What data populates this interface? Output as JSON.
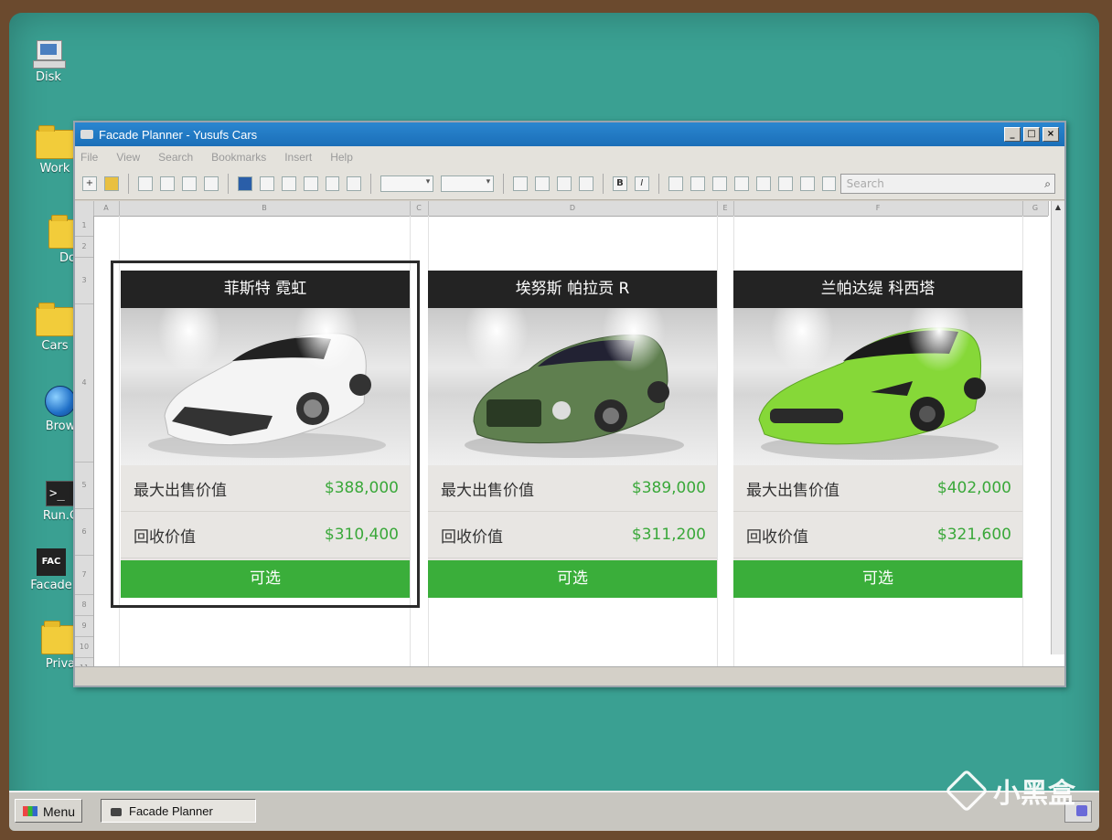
{
  "desktop": {
    "icons": [
      {
        "label": "Disk",
        "icon": "computer-icon"
      },
      {
        "label": "Work",
        "icon": "folder-icon"
      },
      {
        "label": "Do",
        "icon": "folder-icon"
      },
      {
        "label": "Cars",
        "icon": "folder-icon"
      },
      {
        "label": "Brow",
        "icon": "globe-icon"
      },
      {
        "label": "Run.C",
        "icon": "terminal-icon"
      },
      {
        "label": "Facade",
        "icon": "facade-app-icon"
      },
      {
        "label": "Priva",
        "icon": "folder-icon"
      }
    ]
  },
  "window": {
    "title": "Facade Planner - Yusufs Cars",
    "menu": [
      "File",
      "View",
      "Search",
      "Bookmarks",
      "Insert",
      "Help"
    ],
    "search_placeholder": "Search",
    "columns": [
      "A",
      "B",
      "C",
      "D",
      "E",
      "F",
      "G"
    ],
    "rows": [
      "1",
      "2",
      "3",
      "4",
      "5",
      "6",
      "7",
      "8",
      "9",
      "10",
      "11"
    ]
  },
  "cars": [
    {
      "name": "菲斯特 霓虹",
      "max_sale_label": "最大出售价值",
      "max_sale_value": "$388,000",
      "resale_label": "回收价值",
      "resale_value": "$310,400",
      "button": "可选",
      "color": "#f4f4f4",
      "selected": true
    },
    {
      "name": "埃努斯 帕拉贡 R",
      "max_sale_label": "最大出售价值",
      "max_sale_value": "$389,000",
      "resale_label": "回收价值",
      "resale_value": "$311,200",
      "button": "可选",
      "color": "#5f7f4f",
      "selected": false
    },
    {
      "name": "兰帕达缇 科西塔",
      "max_sale_label": "最大出售价值",
      "max_sale_value": "$402,000",
      "resale_label": "回收价值",
      "resale_value": "$321,600",
      "button": "可选",
      "color": "#86d838",
      "selected": false
    }
  ],
  "taskbar": {
    "menu_label": "Menu",
    "task_label": "Facade Planner"
  },
  "watermark": "小黑盒",
  "colors": {
    "desktop": "#3aa092",
    "titlebar": "#1b6fb8",
    "card_header": "#232323",
    "button_green": "#3aae3a",
    "value_green": "#3aa83a"
  }
}
